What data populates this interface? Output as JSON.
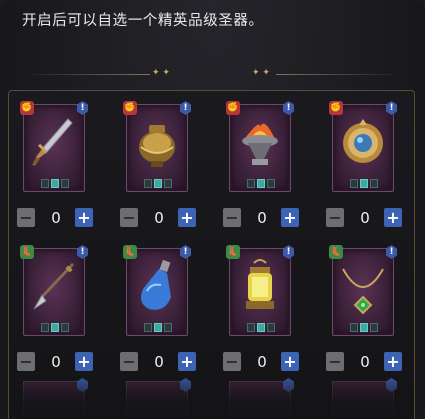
{
  "description": "开启后可以自选一个精英品级圣器。",
  "artifacts": [
    {
      "name_icon": "dagger-icon",
      "badge": "red",
      "badge_icon": "fist-icon",
      "info": "!",
      "pips": [
        false,
        true,
        false
      ],
      "count": "0"
    },
    {
      "name_icon": "golden-urn-icon",
      "badge": "red",
      "badge_icon": "fist-icon",
      "info": "!",
      "pips": [
        false,
        true,
        false
      ],
      "count": "0"
    },
    {
      "name_icon": "fire-brazier-icon",
      "badge": "red",
      "badge_icon": "fist-icon",
      "info": "!",
      "pips": [
        false,
        true,
        false
      ],
      "count": "0"
    },
    {
      "name_icon": "jewel-medallion-icon",
      "badge": "red",
      "badge_icon": "fist-icon",
      "info": "!",
      "pips": [
        false,
        true,
        false
      ],
      "count": "0"
    },
    {
      "name_icon": "spear-icon",
      "badge": "green",
      "badge_icon": "shoe-icon",
      "info": "!",
      "pips": [
        false,
        true,
        false
      ],
      "count": "0"
    },
    {
      "name_icon": "potion-bottle-icon",
      "badge": "green",
      "badge_icon": "shoe-icon",
      "info": "!",
      "pips": [
        false,
        true,
        false
      ],
      "count": "0"
    },
    {
      "name_icon": "lantern-icon",
      "badge": "green",
      "badge_icon": "shoe-icon",
      "info": "!",
      "pips": [
        false,
        true,
        false
      ],
      "count": "0"
    },
    {
      "name_icon": "emerald-necklace-icon",
      "badge": "green",
      "badge_icon": "shoe-icon",
      "info": "!",
      "pips": [
        false,
        true,
        false
      ],
      "count": "0"
    }
  ],
  "stepper": {
    "minus": "−",
    "plus": "+"
  },
  "colors": {
    "red_badge": "#b8363a",
    "green_badge": "#3c8a45",
    "plus": "#3d63b4",
    "frame": "#5a4c33"
  }
}
